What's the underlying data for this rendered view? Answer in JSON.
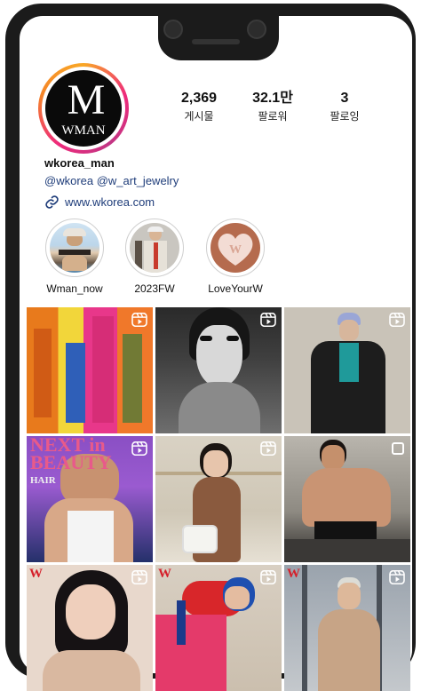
{
  "profile": {
    "username": "wkorea_man",
    "mentions": "@wkorea @w_art_jewelry",
    "website": "www.wkorea.com",
    "avatar_logo": {
      "mark": "M",
      "brand": "WMAN"
    }
  },
  "stats": [
    {
      "value": "2,369",
      "label": "게시물"
    },
    {
      "value": "32.1만",
      "label": "팔로워"
    },
    {
      "value": "3",
      "label": "팔로잉"
    }
  ],
  "highlights": [
    {
      "label": "Wman_now"
    },
    {
      "label": "2023FW"
    },
    {
      "label": "LoveYourW"
    }
  ],
  "grid": {
    "tiles": [
      {
        "type": "reel",
        "icon": "reel-icon"
      },
      {
        "type": "reel",
        "icon": "reel-icon"
      },
      {
        "type": "reel",
        "icon": "reel-icon"
      },
      {
        "type": "reel",
        "icon": "reel-icon",
        "overlay_text": "NEXT in BEAUTY",
        "sub_text": "HAIR"
      },
      {
        "type": "reel",
        "icon": "reel-icon"
      },
      {
        "type": "carousel",
        "icon": "carousel-icon"
      },
      {
        "type": "reel",
        "icon": "reel-icon",
        "badge": "W"
      },
      {
        "type": "reel",
        "icon": "reel-icon",
        "badge": "W"
      },
      {
        "type": "reel",
        "icon": "reel-icon",
        "badge": "W"
      }
    ]
  },
  "colors": {
    "link": "#1f3d7a",
    "ring_start": "#f9a826",
    "ring_end": "#c13584"
  }
}
